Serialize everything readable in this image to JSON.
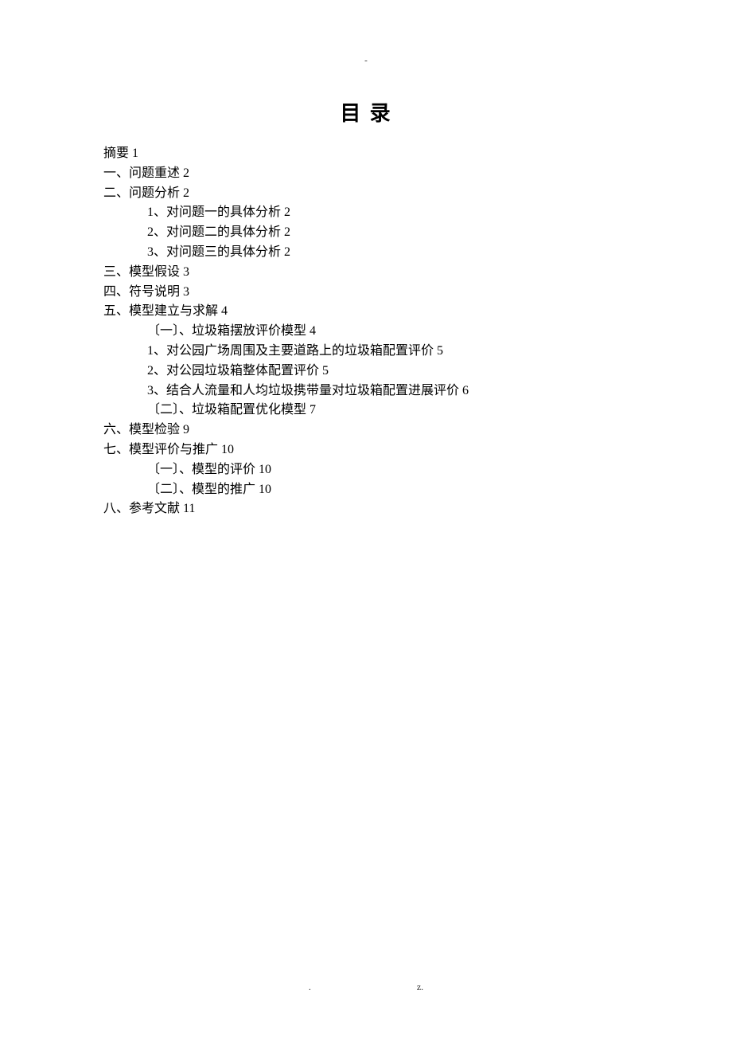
{
  "header": {
    "dash": "-"
  },
  "title": "目 录",
  "toc": [
    {
      "level": 0,
      "text": "摘要 1"
    },
    {
      "level": 0,
      "text": "一、问题重述 2"
    },
    {
      "level": 0,
      "text": "二、问题分析 2"
    },
    {
      "level": 1,
      "text": "1、对问题一的具体分析 2"
    },
    {
      "level": 1,
      "text": "2、对问题二的具体分析 2"
    },
    {
      "level": 1,
      "text": "3、对问题三的具体分析 2"
    },
    {
      "level": 0,
      "text": "三、模型假设 3"
    },
    {
      "level": 0,
      "text": "四、符号说明 3"
    },
    {
      "level": 0,
      "text": "五、模型建立与求解 4"
    },
    {
      "level": 2,
      "text": "〔一〕、垃圾箱摆放评价模型 4"
    },
    {
      "level": 1,
      "text": "1、对公园广场周围及主要道路上的垃圾箱配置评价 5"
    },
    {
      "level": 1,
      "text": "2、对公园垃圾箱整体配置评价 5"
    },
    {
      "level": 1,
      "text": "3、结合人流量和人均垃圾携带量对垃圾箱配置进展评价 6"
    },
    {
      "level": 2,
      "text": "〔二〕、垃圾箱配置优化模型 7"
    },
    {
      "level": 0,
      "text": "六、模型检验 9"
    },
    {
      "level": 0,
      "text": "七、模型评价与推广 10"
    },
    {
      "level": 2,
      "text": "〔一〕、模型的评价 10"
    },
    {
      "level": 2,
      "text": "〔二〕、模型的推广 10"
    },
    {
      "level": 0,
      "text": "八、参考文献 11"
    }
  ],
  "footer": {
    "dot": ".",
    "z": "z."
  }
}
